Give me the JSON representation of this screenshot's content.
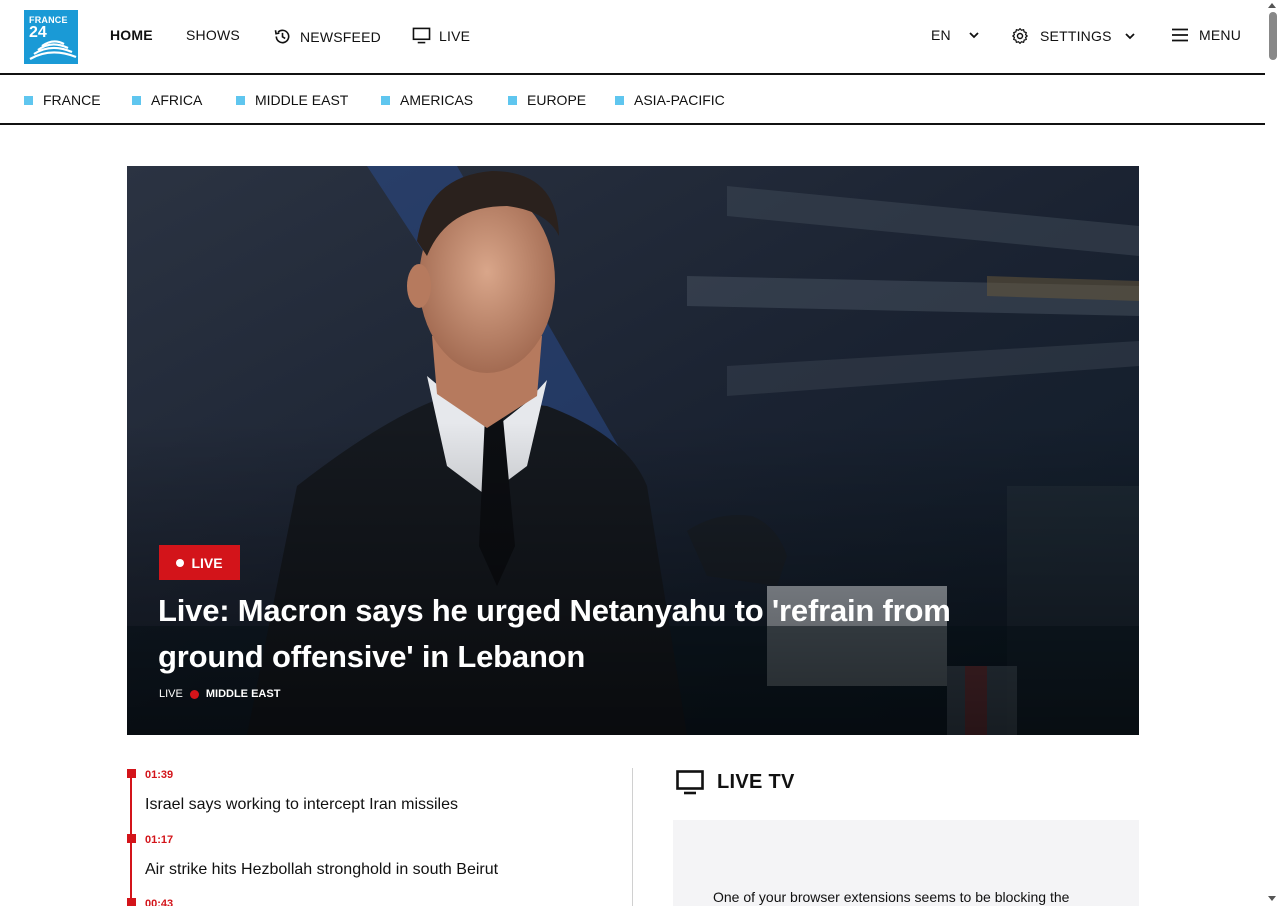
{
  "header": {
    "logo": {
      "line1": "FRANCE",
      "line2": "24",
      "color": "#1a9ad6"
    },
    "nav": [
      {
        "label": "HOME",
        "icon": null
      },
      {
        "label": "SHOWS",
        "icon": null
      },
      {
        "label": "NEWSFEED",
        "icon": "history-icon"
      },
      {
        "label": "LIVE",
        "icon": "tv-icon"
      }
    ],
    "language": {
      "label": "EN",
      "icon": "chevron-down-icon"
    },
    "settings": {
      "label": "SETTINGS",
      "icon": "gear-icon"
    },
    "menu": {
      "label": "MENU",
      "icon": "hamburger-icon"
    }
  },
  "regions": [
    "FRANCE",
    "AFRICA",
    "MIDDLE EAST",
    "AMERICAS",
    "EUROPE",
    "ASIA-PACIFIC"
  ],
  "colors": {
    "accent_red": "#d3141a",
    "region_square": "#5fc6ef",
    "brand_blue": "#1a9ad6"
  },
  "hero": {
    "badge": "LIVE",
    "title": "Live: Macron says he urged Netanyahu to 'refrain from ground offensive' in Lebanon",
    "meta_type": "LIVE",
    "meta_category": "MIDDLE EAST"
  },
  "live_feed": [
    {
      "time": "01:39",
      "text": "Israel says working to intercept Iran missiles"
    },
    {
      "time": "01:17",
      "text": "Air strike hits Hezbollah stronghold in south Beirut"
    },
    {
      "time": "00:43",
      "text": ""
    }
  ],
  "live_tv": {
    "title": "LIVE TV",
    "message": "One of your browser extensions seems to be blocking the"
  }
}
